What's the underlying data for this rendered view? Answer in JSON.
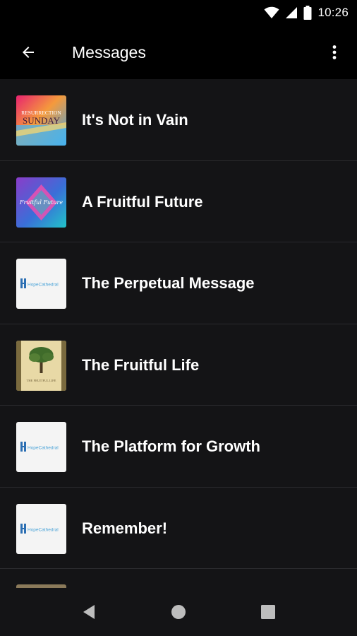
{
  "status_bar": {
    "time": "10:26",
    "icons": [
      "wifi-icon",
      "signal-icon",
      "battery-icon"
    ]
  },
  "app_bar": {
    "title": "Messages",
    "back_icon": "arrow-back-icon",
    "menu_icon": "more-vert-icon"
  },
  "messages": [
    {
      "title": "It's Not in Vain",
      "thumbnail": "resurrection-sunday-art"
    },
    {
      "title": "A Fruitful Future",
      "thumbnail": "fruitful-future-art"
    },
    {
      "title": "The Perpetual Message",
      "thumbnail": "hope-cathedral-logo"
    },
    {
      "title": "The Fruitful Life",
      "thumbnail": "tree-art"
    },
    {
      "title": "The Platform for Growth",
      "thumbnail": "hope-cathedral-logo"
    },
    {
      "title": "Remember!",
      "thumbnail": "hope-cathedral-logo"
    }
  ],
  "thumb_text": {
    "resurrection": "RESURRECTION",
    "sunday": "SUNDAY",
    "fruitful_future": "Fruitful Future",
    "hope": "HopeCathedral",
    "tree_caption": "THE FRUITFUL LIFE"
  },
  "nav_bar": {
    "icons": [
      "back-triangle-icon",
      "home-circle-icon",
      "recents-square-icon"
    ]
  },
  "colors": {
    "background": "#141416",
    "app_bar": "#000000",
    "divider": "#2a2a2d",
    "text": "#ffffff"
  }
}
